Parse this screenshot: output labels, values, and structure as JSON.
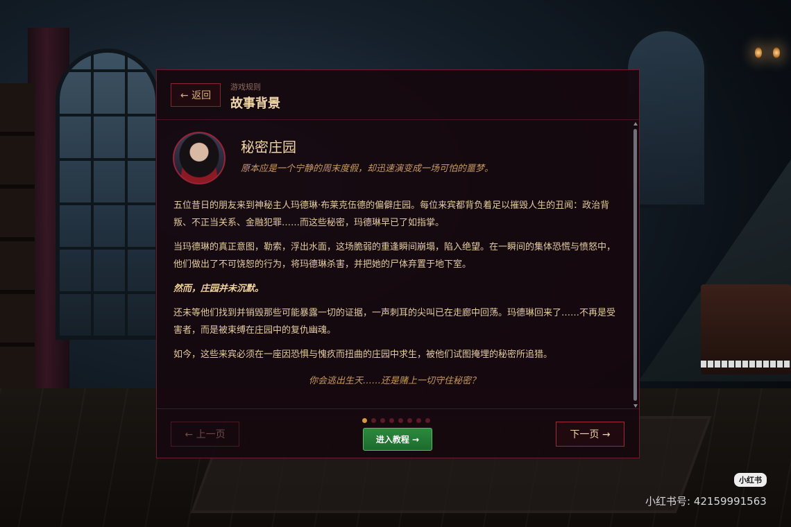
{
  "header": {
    "back_label": "← 返回",
    "breadcrumb": "游戏规则",
    "title": "故事背景"
  },
  "story": {
    "title": "秘密庄园",
    "subtitle": "原本应是一个宁静的周末度假，却迅速演变成一场可怕的噩梦。",
    "paragraphs": [
      "五位昔日的朋友来到神秘主人玛德琳·布莱克伍德的偏僻庄园。每位来宾都背负着足以摧毁人生的丑闻：政治背叛、不正当关系、金融犯罪……而这些秘密，玛德琳早已了如指掌。",
      "当玛德琳的真正意图，勒索，浮出水面，这场脆弱的重逢瞬间崩塌，陷入绝望。在一瞬间的集体恐慌与愤怒中，他们做出了不可饶恕的行为，将玛德琳杀害，并把她的尸体弃置于地下室。",
      "然而，庄园并未沉默。",
      "还未等他们找到并销毁那些可能暴露一切的证据，一声刺耳的尖叫已在走廊中回荡。玛德琳回来了……不再是受害者，而是被束缚在庄园中的复仇幽魂。",
      "如今，这些来宾必须在一座因恐惧与愧疚而扭曲的庄园中求生，被他们试图掩埋的秘密所追猎。"
    ],
    "closing": "你会逃出生天……还是赌上一切守住秘密？"
  },
  "footer": {
    "prev_label": "← 上一页",
    "tutorial_label": "进入教程 →",
    "next_label": "下一页 →",
    "page_count": 8,
    "current_page": 1
  },
  "watermark": {
    "logo_text": "小红书",
    "id_text": "小红书号: 42159991563"
  },
  "colors": {
    "accent_gold": "#f0d6a8",
    "border_red": "#8a2434",
    "tutorial_green": "#2c8a3e"
  },
  "icons": {
    "back": "arrow-left-icon",
    "next": "arrow-right-icon"
  }
}
